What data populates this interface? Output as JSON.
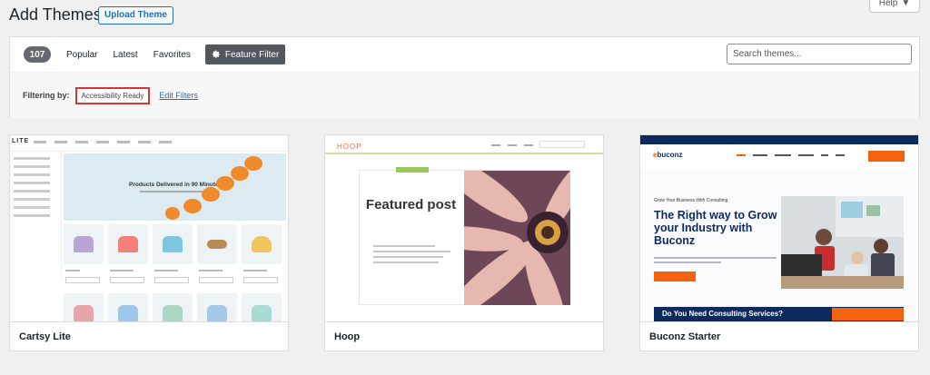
{
  "header": {
    "title": "Add Themes",
    "upload_label": "Upload Theme",
    "help_label": "Help"
  },
  "filter": {
    "count": "107",
    "tabs": [
      "Popular",
      "Latest",
      "Favorites"
    ],
    "feature_filter_label": "Feature Filter",
    "search_placeholder": "Search themes...",
    "filtering_by_label": "Filtering by:",
    "active_tag": "Accessibility Ready",
    "edit_filters_label": "Edit Filters"
  },
  "themes": [
    {
      "name": "Cartsy Lite",
      "preview": {
        "logo": "LITE",
        "hero_title": "Products Delivered in 90 Minutes"
      }
    },
    {
      "name": "Hoop",
      "preview": {
        "logo": "HOOP",
        "headline": "Featured post"
      }
    },
    {
      "name": "Buconz Starter",
      "preview": {
        "logo_prefix": "e",
        "logo_rest": "buconz",
        "tagline": "Grow Your Business With Consulting",
        "headline": "The Right way to Grow your Industry with Buconz",
        "band_text": "Do You Need Consulting Services?"
      }
    }
  ],
  "colors": {
    "accent": "#2271b1",
    "highlight_border": "#d63638",
    "feature_button": "#50575e",
    "count_badge": "#646970",
    "buconz_navy": "#0d2a5f",
    "buconz_orange": "#f5620f",
    "hoop_green": "#9acb5a"
  },
  "icons": {
    "help_dropdown": "caret-down-icon",
    "feature_filter": "gear-icon"
  }
}
